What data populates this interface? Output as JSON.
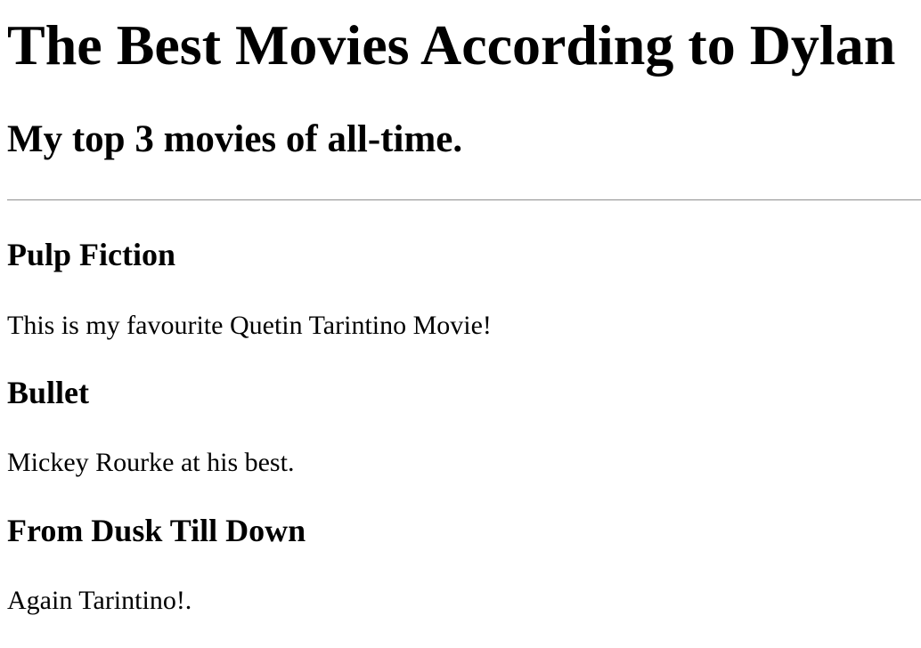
{
  "header": {
    "title": "The Best Movies According to Dylan",
    "subtitle": "My top 3 movies of all-time."
  },
  "movies": [
    {
      "title": "Pulp Fiction",
      "description": "This is my favourite Quetin Tarintino Movie!"
    },
    {
      "title": "Bullet",
      "description": "Mickey Rourke at his best."
    },
    {
      "title": "From Dusk Till Down",
      "description": "Again Tarintino!."
    }
  ]
}
